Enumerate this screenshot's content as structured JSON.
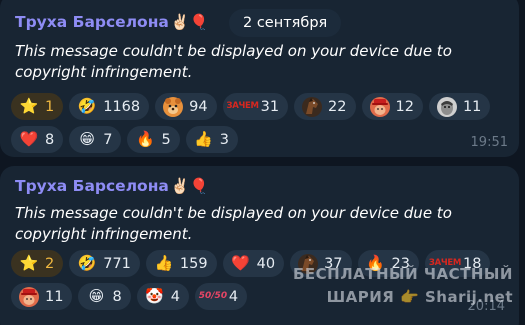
{
  "date_label": "2 сентября",
  "messages": [
    {
      "sender": "Труха Барселона",
      "sender_emoji": "✌🏻🎈",
      "text": "This message couldn't be displayed on your device due to copyright infringement.",
      "time": "19:51",
      "reactions": [
        {
          "icon": "star-icon",
          "glyph": "⭐",
          "count": "1",
          "paid": true
        },
        {
          "icon": "rofl-icon",
          "glyph": "🤣",
          "count": "1168"
        },
        {
          "icon": "bear-face-icon",
          "glyph": "",
          "count": "94"
        },
        {
          "icon": "zachem-sticker-icon",
          "glyph": "ЗАЧЕМ",
          "count": "31"
        },
        {
          "icon": "horse-icon",
          "glyph": "",
          "count": "22"
        },
        {
          "icon": "hat-man-icon",
          "glyph": "",
          "count": "12"
        },
        {
          "icon": "grey-face-icon",
          "glyph": "",
          "count": "11"
        },
        {
          "icon": "red-heart-icon",
          "glyph": "❤️",
          "count": "8"
        },
        {
          "icon": "grin-icon",
          "glyph": "😁",
          "count": "7"
        },
        {
          "icon": "fire-icon",
          "glyph": "🔥",
          "count": "5"
        },
        {
          "icon": "thumbs-up-icon",
          "glyph": "👍",
          "count": "3"
        }
      ]
    },
    {
      "sender": "Труха Барселона",
      "sender_emoji": "✌🏻🎈",
      "text": "This message couldn't be displayed on your device due to copyright infringement.",
      "time": "20:14",
      "reactions": [
        {
          "icon": "star-icon",
          "glyph": "⭐",
          "count": "2",
          "paid": true
        },
        {
          "icon": "rofl-icon",
          "glyph": "🤣",
          "count": "771"
        },
        {
          "icon": "thumbs-up-icon",
          "glyph": "👍",
          "count": "159"
        },
        {
          "icon": "red-heart-icon",
          "glyph": "❤️",
          "count": "40"
        },
        {
          "icon": "horse-icon",
          "glyph": "",
          "count": "37"
        },
        {
          "icon": "fire-icon",
          "glyph": "🔥",
          "count": "23"
        },
        {
          "icon": "zachem-sticker-icon",
          "glyph": "ЗАЧЕМ",
          "count": "18"
        },
        {
          "icon": "hat-man-icon",
          "glyph": "",
          "count": "11"
        },
        {
          "icon": "grin-icon",
          "glyph": "😁",
          "count": "8"
        },
        {
          "icon": "clown-icon",
          "glyph": "🤡",
          "count": "4"
        },
        {
          "icon": "fifty-fifty-icon",
          "glyph": "50/50",
          "count": "4"
        }
      ]
    }
  ],
  "watermark": {
    "line1": "БЕСПЛАТНЫЙ ЧАСТНЫЙ",
    "line2": "ШАРИЯ 👉 Sharij.net"
  }
}
